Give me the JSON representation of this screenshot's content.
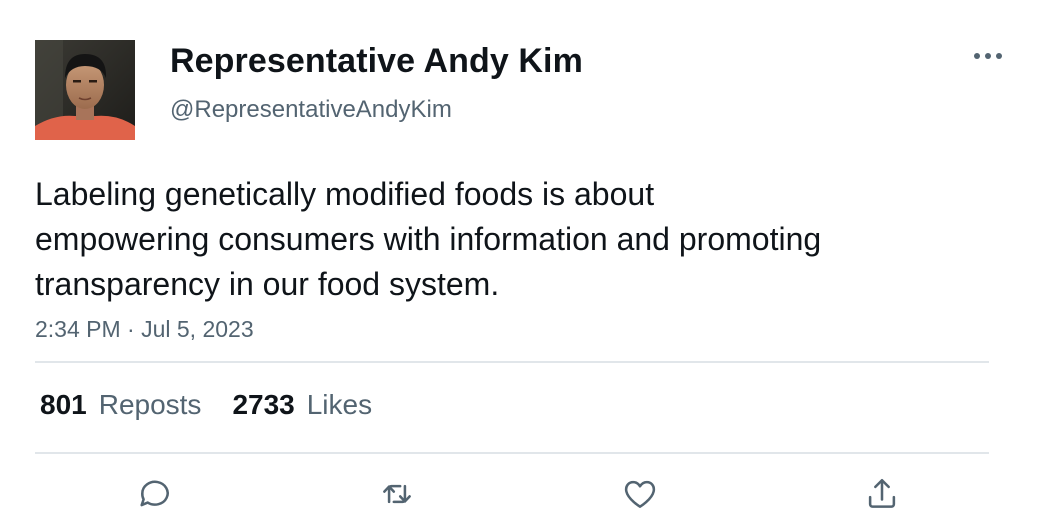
{
  "author": {
    "name": "Representative Andy Kim",
    "handle": "@RepresentativeAndyKim"
  },
  "tweet": {
    "text": "Labeling genetically modified foods is about\nempowering consumers with information and promoting\ntransparency in our food system.",
    "timestamp": "2:34 PM · Jul 5, 2023"
  },
  "stats": {
    "reposts_count": "801",
    "reposts_label": "Reposts",
    "likes_count": "2733",
    "likes_label": "Likes"
  },
  "actions": [
    {
      "icon": "reply-icon"
    },
    {
      "icon": "repost-icon"
    },
    {
      "icon": "like-icon"
    },
    {
      "icon": "share-icon"
    }
  ],
  "colors": {
    "primary_text": "#0f1419",
    "secondary_text": "#536471",
    "divider": "#e1e6ea"
  }
}
